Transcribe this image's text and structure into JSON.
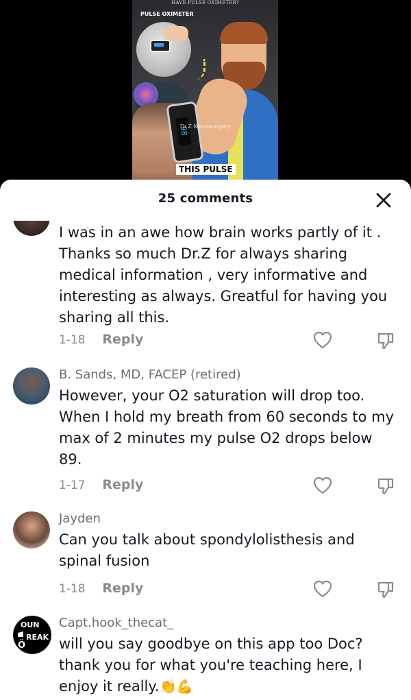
{
  "video": {
    "caption_top": "HAVE PULSE OXIMETER?",
    "label": "PULSE OXIMETER",
    "screen_reading": "98",
    "overlay_text": "Dr.Z Neurosurgery",
    "tag": "THIS PULSE"
  },
  "comments_panel": {
    "title": "25 comments",
    "reply_label": "Reply",
    "comments": [
      {
        "user": "",
        "text": "I was in an awe how brain works partly of it . Thanks so much Dr.Z for always sharing medical information , very informative and interesting as always. Greatful for having you sharing all this.",
        "date": "1-18"
      },
      {
        "user": "B. Sands, MD, FACEP (retired)",
        "text": "However, your O2 saturation will drop too. When I hold my breath from 60 seconds to my max of 2 minutes my pulse O2 drops below 89.",
        "date": "1-17"
      },
      {
        "user": "Jayden",
        "text": "Can you talk about spondylolisthesis and spinal fusion",
        "date": "1-18"
      },
      {
        "user": "Capt.hook_thecat_",
        "text": "will you say goodbye on this app too Doc? thank you for what you're teaching here, I enjoy it really.",
        "emojis": [
          "👏",
          "💪"
        ],
        "date": ""
      }
    ]
  },
  "icons": {
    "close": "close-icon",
    "like": "heart-outline-icon",
    "dislike": "thumbs-down-outline-icon"
  },
  "colors": {
    "text_primary": "#161823",
    "text_secondary": "#8a8b91",
    "sheet_bg": "#ffffff"
  }
}
